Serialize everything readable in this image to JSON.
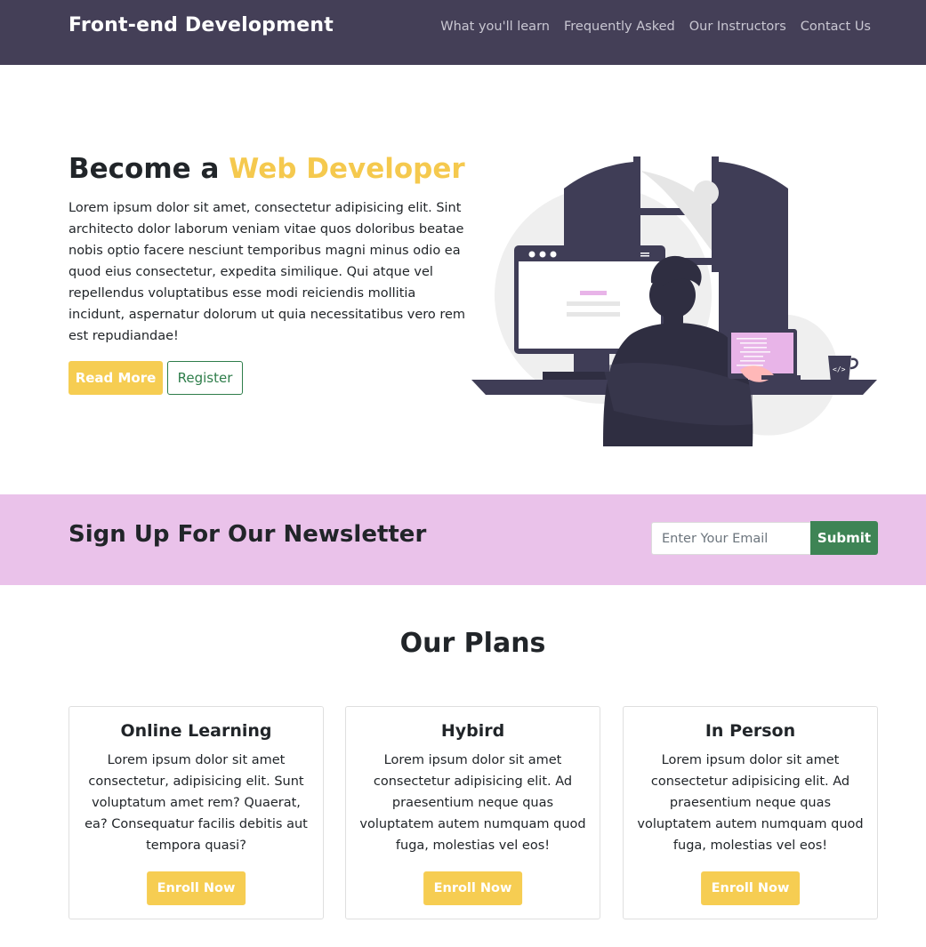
{
  "navbar": {
    "brand": "Front-end Development",
    "links": [
      "What you'll learn",
      "Frequently Asked",
      "Our Instructors",
      "Contact Us"
    ]
  },
  "hero": {
    "title_prefix": "Become a",
    "title_accent": "Web Developer",
    "text": "Lorem ipsum dolor sit amet, consectetur adipisicing elit. Sint architecto dolor laborum veniam vitae quos doloribus beatae nobis optio facere nesciunt temporibus magni minus odio ea quod eius consectetur, expedita similique. Qui atque vel repellendus voluptatibus esse modi reiciendis mollitia incidunt, aspernatur dolorum ut quia necessitatibus vero rem est repudiandae!",
    "read_more_label": "Read More",
    "register_label": "Register",
    "accent_color": "#f5c94e"
  },
  "newsletter": {
    "title": "Sign Up For Our Newsletter",
    "email_placeholder": "Enter Your Email",
    "submit_label": "Submit",
    "background": "#eac2ea"
  },
  "plans": {
    "title": "Our Plans",
    "cards": [
      {
        "title": "Online Learning",
        "text": "Lorem ipsum dolor sit amet consectetur, adipisicing elit. Sunt voluptatum amet rem? Quaerat, ea? Consequatur facilis debitis aut tempora quasi?",
        "button": "Enroll Now"
      },
      {
        "title": "Hybird",
        "text": "Lorem ipsum dolor sit amet consectetur adipisicing elit. Ad praesentium neque quas voluptatem autem numquam quod fuga, molestias vel eos!",
        "button": "Enroll Now"
      },
      {
        "title": "In Person",
        "text": "Lorem ipsum dolor sit amet consectetur adipisicing elit. Ad praesentium neque quas voluptatem autem numquam quod fuga, molestias vel eos!",
        "button": "Enroll Now"
      }
    ]
  }
}
